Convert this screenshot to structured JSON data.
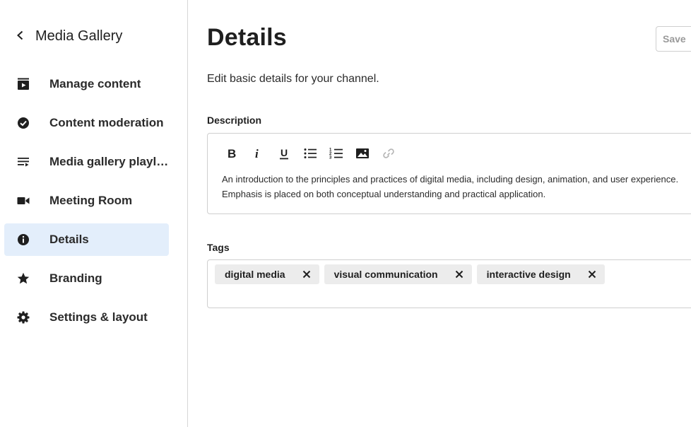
{
  "sidebar": {
    "back_label": "Media Gallery",
    "items": [
      {
        "label": "Manage content",
        "icon": "playlist-play-icon",
        "active": false
      },
      {
        "label": "Content moderation",
        "icon": "check-circle-icon",
        "active": false
      },
      {
        "label": "Media gallery playlists",
        "icon": "queue-list-icon",
        "active": false
      },
      {
        "label": "Meeting Room",
        "icon": "video-camera-icon",
        "active": false
      },
      {
        "label": "Details",
        "icon": "info-circle-icon",
        "active": true
      },
      {
        "label": "Branding",
        "icon": "star-icon",
        "active": false
      },
      {
        "label": "Settings & layout",
        "icon": "gear-icon",
        "active": false
      }
    ]
  },
  "main": {
    "title": "Details",
    "save_label": "Save",
    "subtitle": "Edit basic details for your channel.",
    "description": {
      "label": "Description",
      "toolbar": [
        "bold",
        "italic",
        "underline",
        "bulleted-list",
        "numbered-list",
        "image",
        "link"
      ],
      "text": "An introduction to the principles and practices of digital media, including design, animation, and user experience. Emphasis is placed on both conceptual understanding and practical application."
    },
    "tags": {
      "label": "Tags",
      "items": [
        "digital media",
        "visual communication",
        "interactive design"
      ]
    }
  },
  "colors": {
    "active_bg": "#e3eefb",
    "border": "#cfcfcf",
    "tag_bg": "#ececec",
    "save_text": "#9a9a9a"
  }
}
